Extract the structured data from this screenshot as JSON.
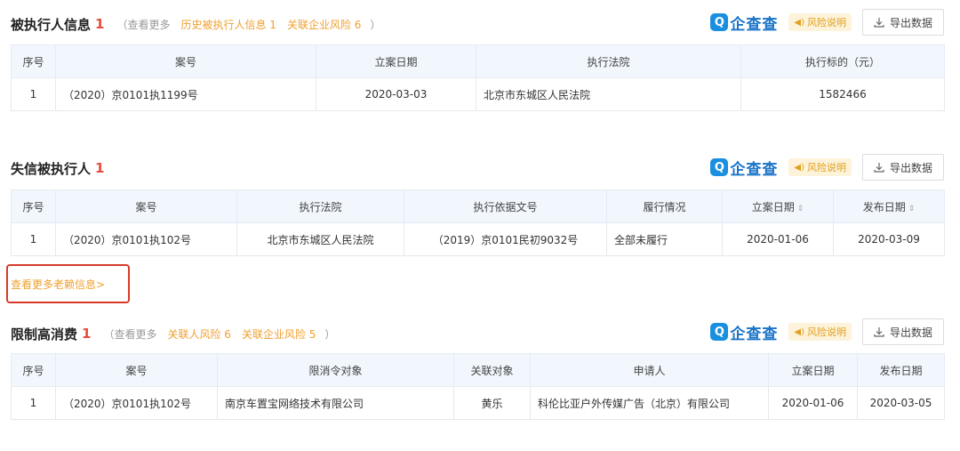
{
  "common": {
    "logo_mark": "Q",
    "logo_text": "企查查",
    "risk_label": "风险说明",
    "export_label": "导出数据"
  },
  "s1": {
    "title": "被执行人信息",
    "count": "1",
    "paren_open": "（",
    "view_more": "查看更多",
    "history_link": "历史被执行人信息 1",
    "related_link": "关联企业风险 6",
    "paren_close": "）",
    "headers": [
      "序号",
      "案号",
      "立案日期",
      "执行法院",
      "执行标的（元）"
    ],
    "rows": [
      [
        "1",
        "（2020）京0101执1199号",
        "2020-03-03",
        "北京市东城区人民法院",
        "1582466"
      ]
    ]
  },
  "s2": {
    "title": "失信被执行人",
    "count": "1",
    "headers": [
      "序号",
      "案号",
      "执行法院",
      "执行依据文号",
      "履行情况",
      "立案日期",
      "发布日期"
    ],
    "rows": [
      [
        "1",
        "（2020）京0101执102号",
        "北京市东城区人民法院",
        "（2019）京0101民初9032号",
        "全部未履行",
        "2020-01-06",
        "2020-03-09"
      ]
    ],
    "more_link": "查看更多老赖信息>"
  },
  "s3": {
    "title": "限制高消费",
    "count": "1",
    "paren_open": "（",
    "view_more": "查看更多",
    "person_link": "关联人风险 6",
    "related_link": "关联企业风险 5",
    "paren_close": "）",
    "headers": [
      "序号",
      "案号",
      "限消令对象",
      "关联对象",
      "申请人",
      "立案日期",
      "发布日期"
    ],
    "rows": [
      [
        "1",
        "（2020）京0101执102号",
        "南京车置宝网络技术有限公司",
        "黄乐",
        "科伦比亚户外传媒广告（北京）有限公司",
        "2020-01-06",
        "2020-03-05"
      ]
    ]
  }
}
